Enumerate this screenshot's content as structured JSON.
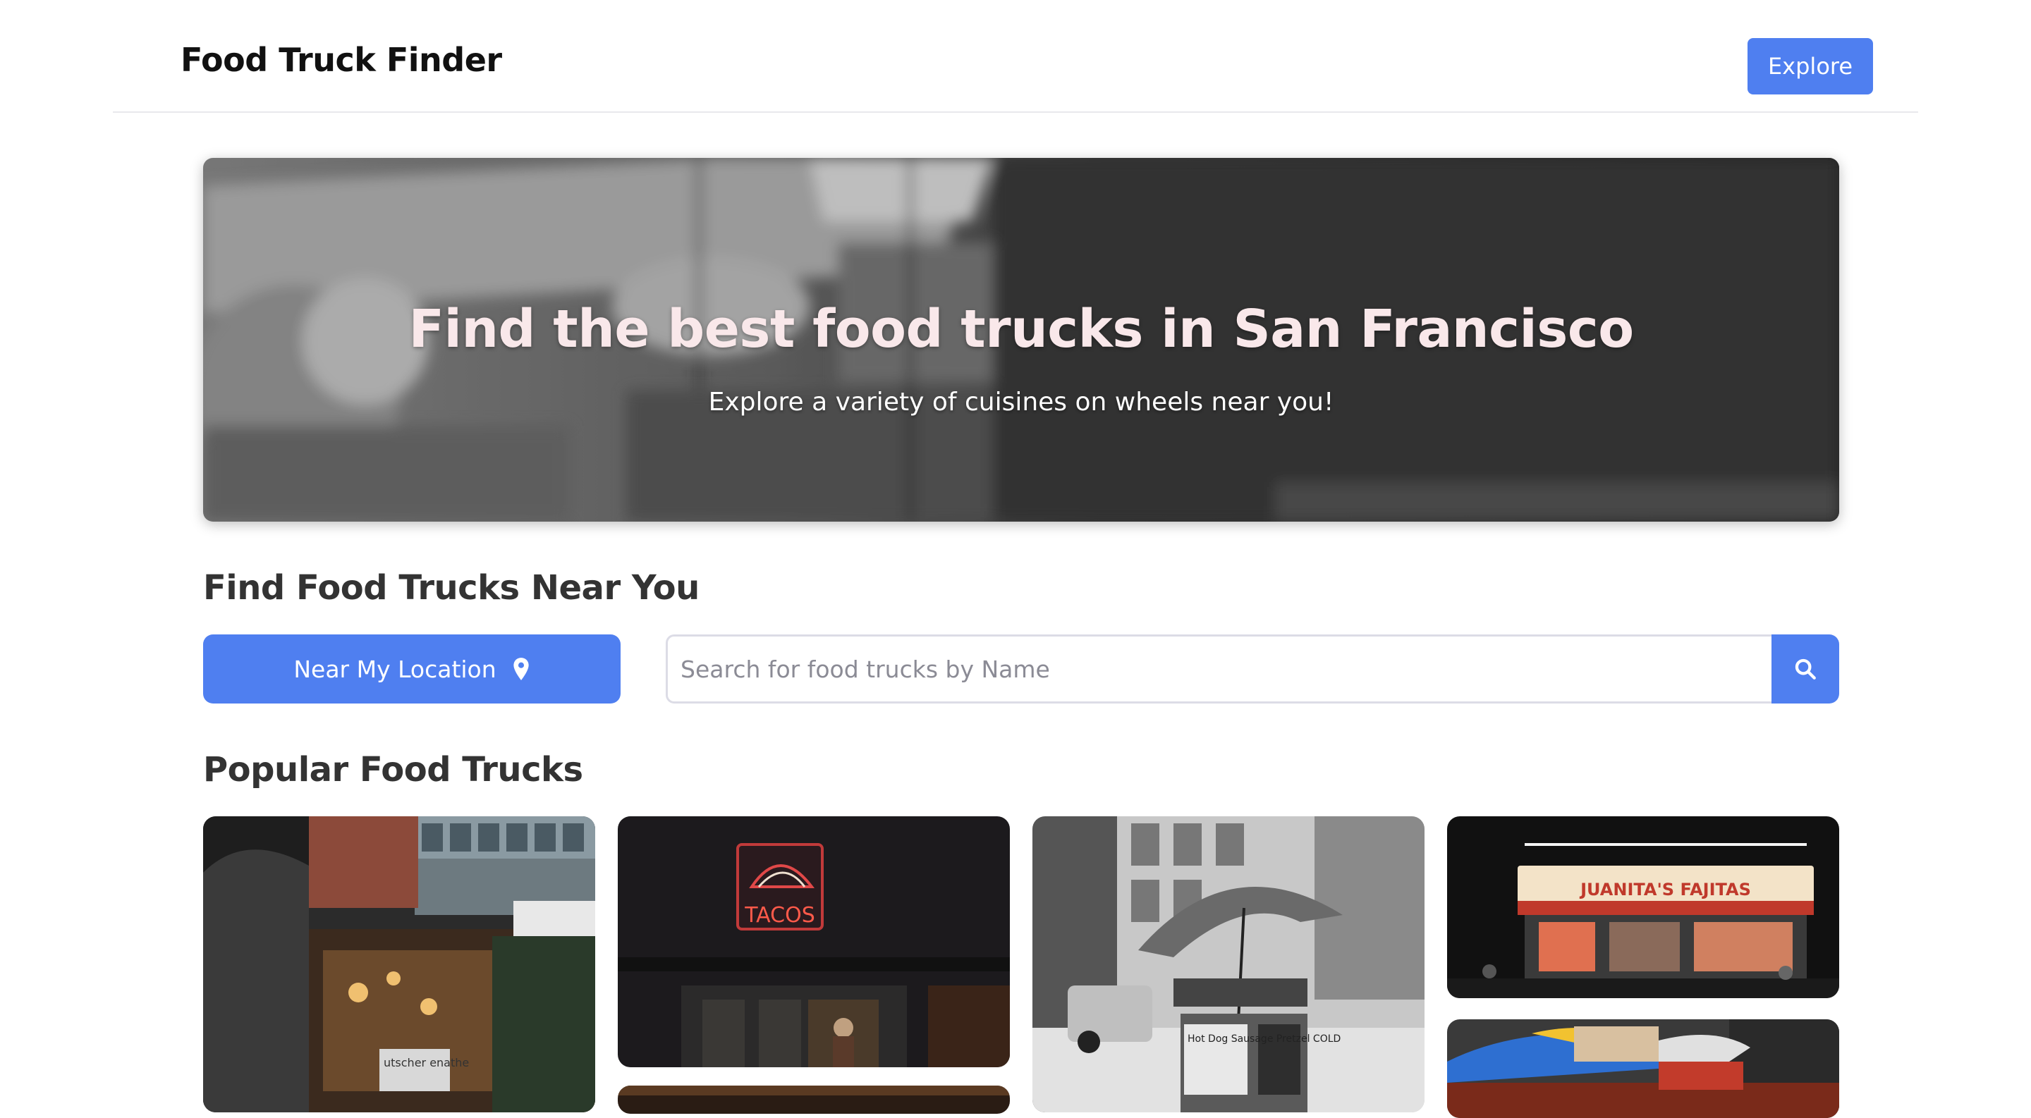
{
  "header": {
    "title": "Food Truck Finder",
    "explore_label": "Explore"
  },
  "hero": {
    "title": "Find the best food trucks in San Francisco",
    "subtitle": "Explore a variety of cuisines on wheels near you!"
  },
  "near": {
    "heading": "Find Food Trucks Near You",
    "location_label": "Near My Location",
    "search_placeholder": "Search for food trucks by Name"
  },
  "popular": {
    "heading": "Popular Food Trucks",
    "cards": [
      {
        "sign_text": "utscher enathe"
      },
      {
        "sign_text": "TACOS"
      },
      {
        "sign_text": "Hot Dog Sausage Pretzel COLD"
      },
      {
        "sign_text": "JUANITA'S FAJITAS"
      },
      {
        "sign_text": ""
      },
      {
        "sign_text": ""
      }
    ]
  },
  "icons": {
    "location": "map-pin-icon",
    "search": "search-icon"
  },
  "colors": {
    "accent": "#4f7ff0",
    "heading": "#333333"
  }
}
